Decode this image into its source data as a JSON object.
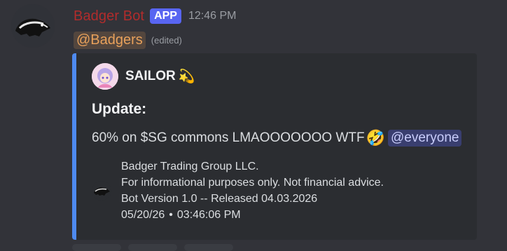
{
  "message": {
    "username": "Badger Bot",
    "app_tag": "APP",
    "timestamp": "12:46 PM",
    "mention_role": "@Badgers",
    "edited_label": "(edited)"
  },
  "embed": {
    "accent_color": "#4e8af0",
    "author": {
      "name": "SAILOR",
      "emoji": "💫"
    },
    "title": "Update:",
    "description": "60% on $SG commons LMAOOOOOOO WTF",
    "description_emoji": "🤣",
    "mention_everyone": "@everyone",
    "footer": {
      "line1": "Badger Trading Group LLC.",
      "line2": "For informational purposes only. Not financial advice.",
      "line3": "Bot Version 1.0 -- Released 04.03.2026",
      "date": "05/20/26",
      "separator": "•",
      "time": "03:46:06 PM"
    }
  },
  "colors": {
    "username": "#b12c2c",
    "app_tag": "#5865f2",
    "role_mention": "#e8a15b",
    "everyone_mention": "#5865f2"
  }
}
